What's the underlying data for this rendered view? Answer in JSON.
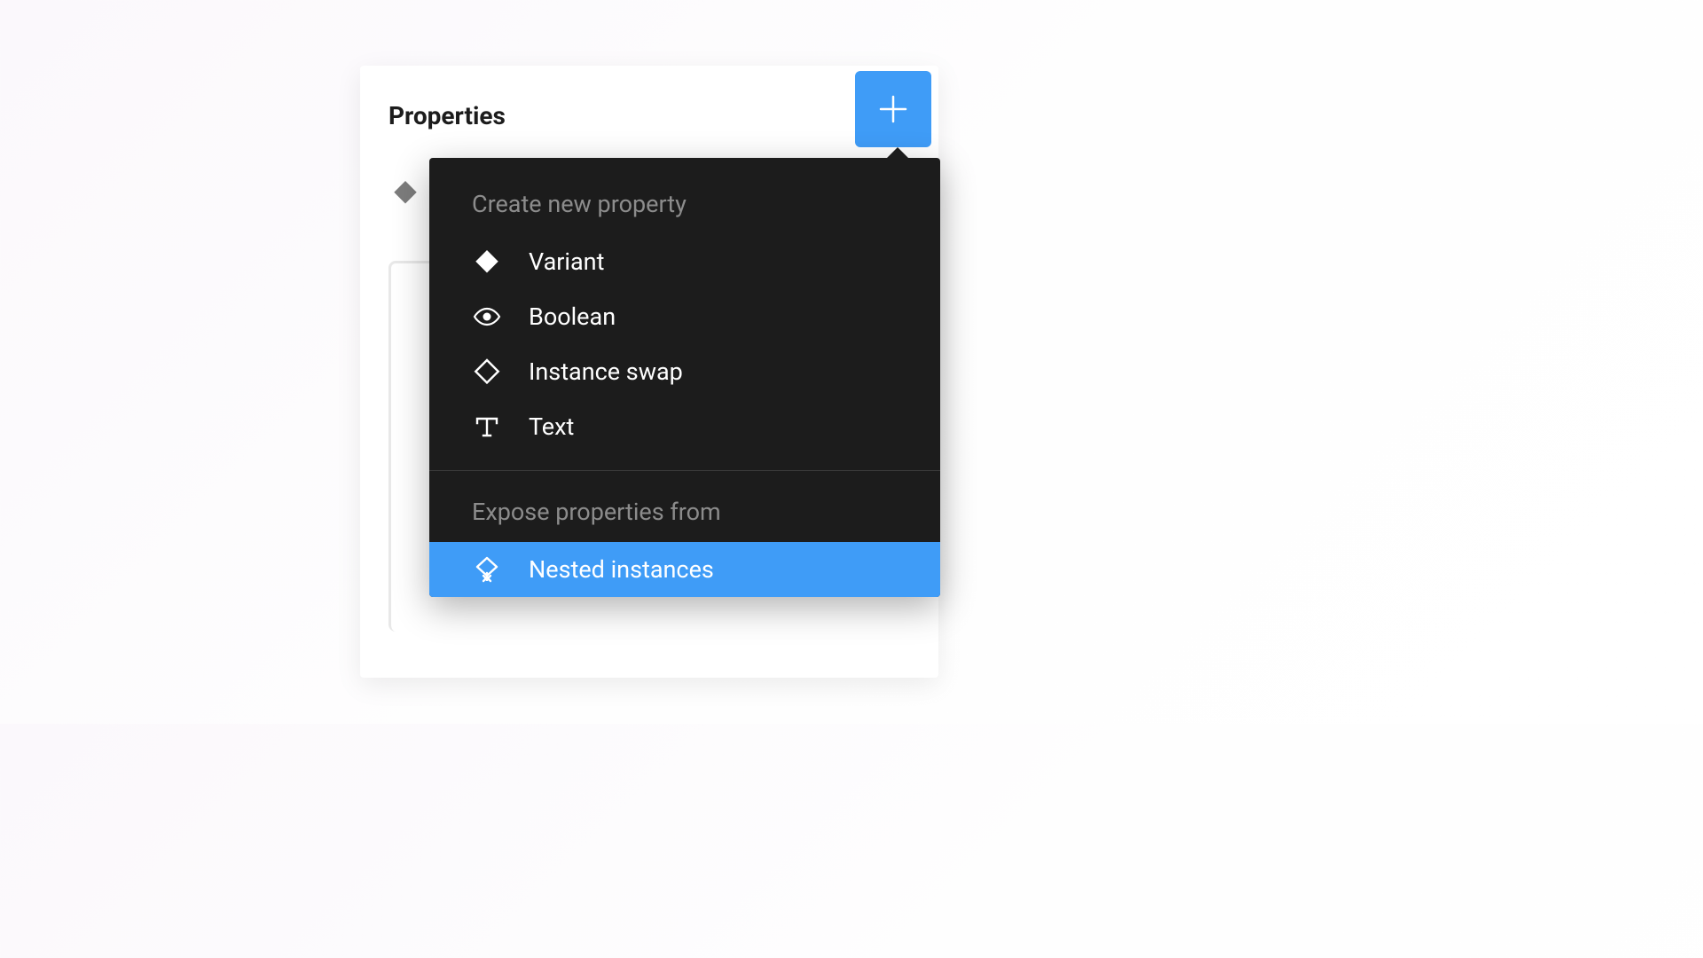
{
  "panel": {
    "title": "Properties"
  },
  "dropdown": {
    "section1_title": "Create new property",
    "section2_title": "Expose properties from",
    "items": {
      "variant": "Variant",
      "boolean": "Boolean",
      "instance_swap": "Instance swap",
      "text": "Text",
      "nested_instances": "Nested instances"
    }
  },
  "colors": {
    "accent": "#3f9cf7",
    "dropdown_bg": "#1c1c1c"
  }
}
